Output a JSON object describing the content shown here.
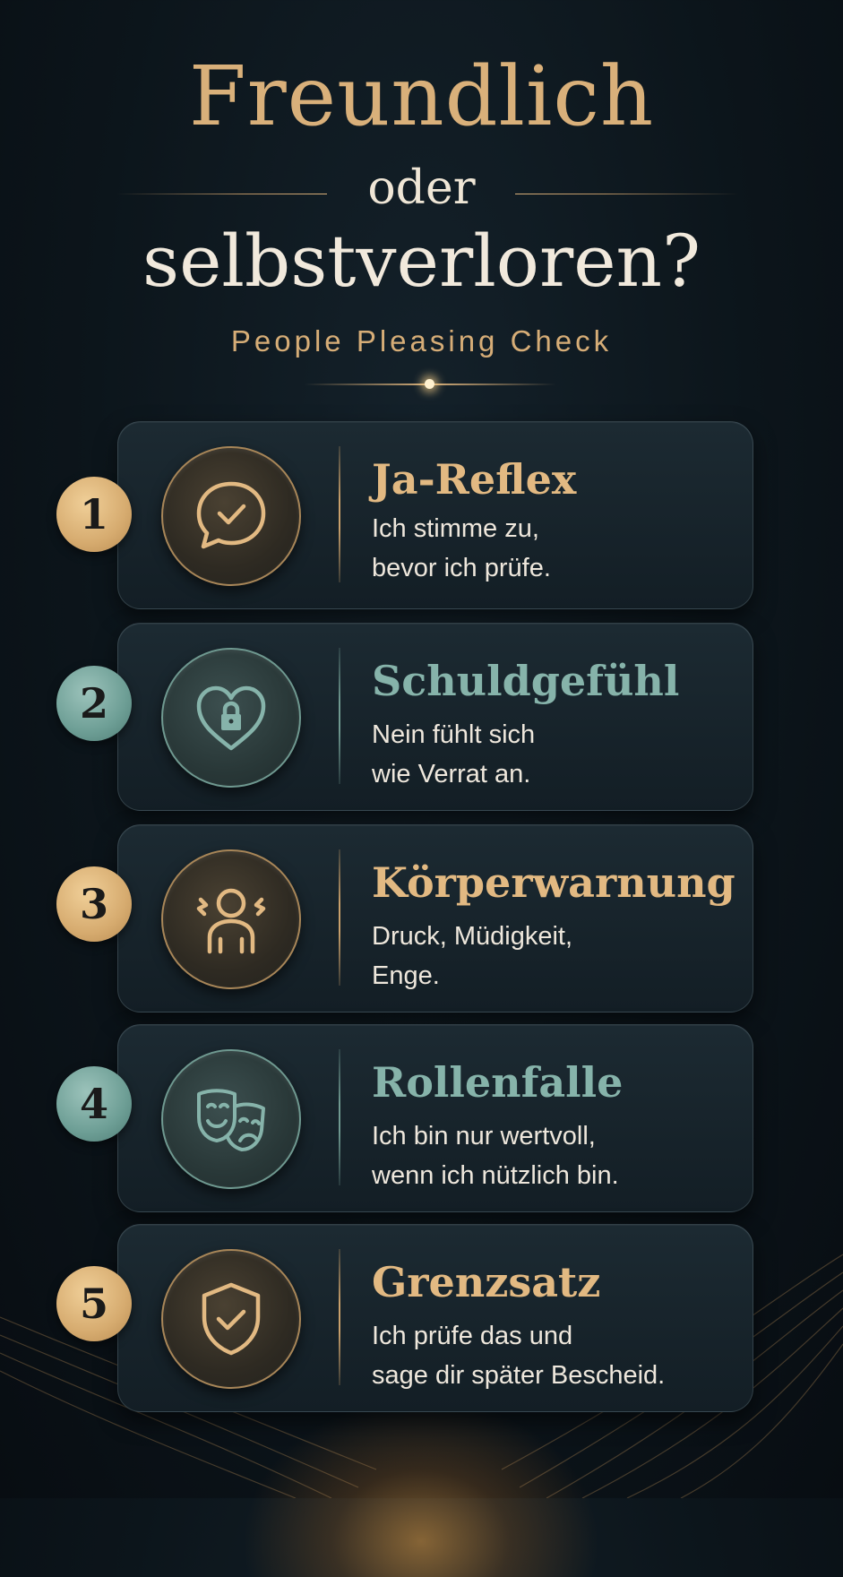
{
  "header": {
    "title_line1": "Freundlich",
    "title_connector": "oder",
    "title_line2": "selbstverloren?",
    "subtitle": "People Pleasing Check"
  },
  "colors": {
    "gold": "#d9b07a",
    "teal": "#86b3aa",
    "background": "#0c151b",
    "text": "#eee7dc"
  },
  "items": [
    {
      "number": "1",
      "accent": "gold",
      "icon": "chat-check-icon",
      "title": "Ja-Reflex",
      "desc_line1": "Ich stimme zu,",
      "desc_line2": "bevor ich prüfe."
    },
    {
      "number": "2",
      "accent": "teal",
      "icon": "heart-lock-icon",
      "title": "Schuldgefühl",
      "desc_line1": "Nein fühlt sich",
      "desc_line2": "wie Verrat an."
    },
    {
      "number": "3",
      "accent": "gold",
      "icon": "stressed-person-icon",
      "title": "Körperwarnung",
      "desc_line1": "Druck, Müdigkeit,",
      "desc_line2": "Enge."
    },
    {
      "number": "4",
      "accent": "teal",
      "icon": "theater-masks-icon",
      "title": "Rollenfalle",
      "desc_line1": "Ich bin nur wertvoll,",
      "desc_line2": "wenn ich nützlich bin."
    },
    {
      "number": "5",
      "accent": "gold",
      "icon": "shield-check-icon",
      "title": "Grenzsatz",
      "desc_line1": "Ich prüfe das und",
      "desc_line2": "sage dir später Bescheid."
    }
  ]
}
